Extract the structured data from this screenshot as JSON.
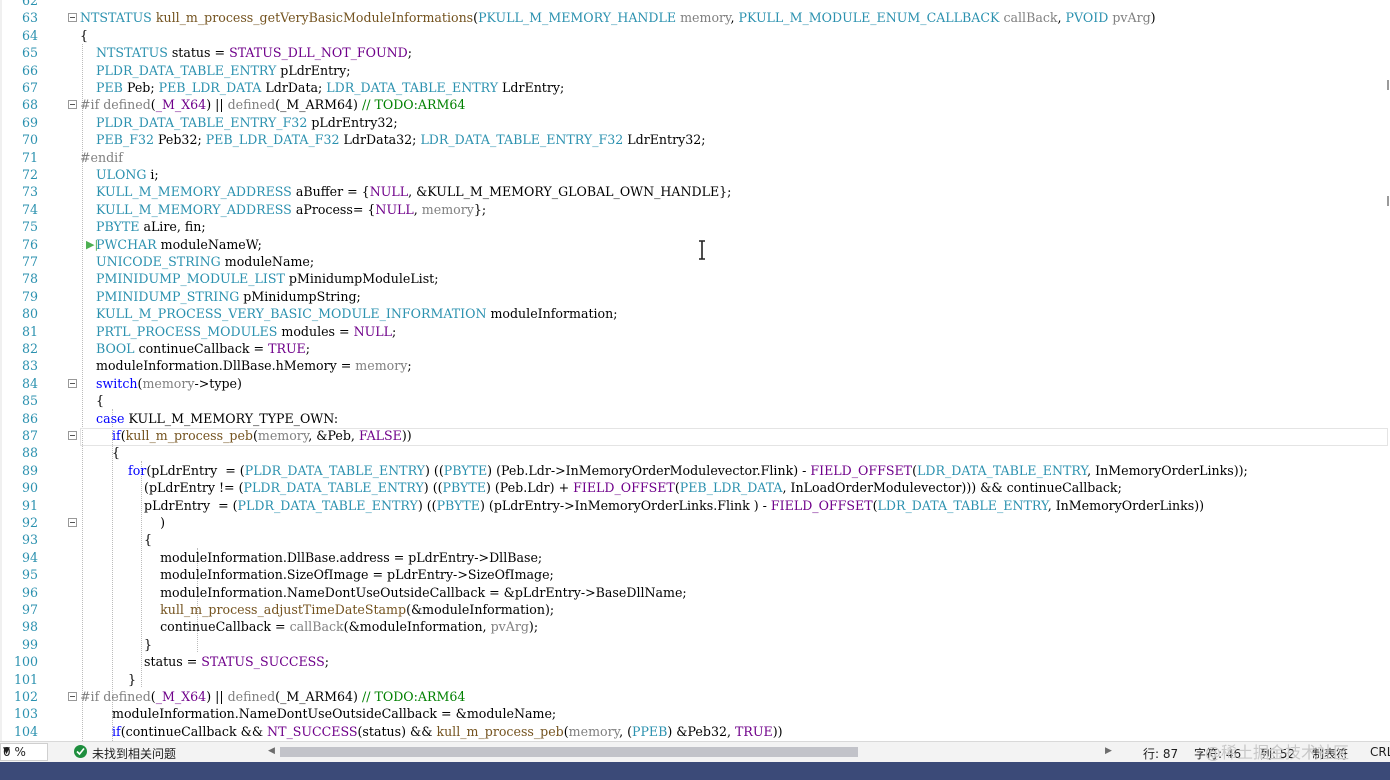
{
  "code_lines": [
    {
      "n": "62",
      "segs": []
    },
    {
      "n": "63",
      "fold": true,
      "segs": [
        [
          "t-type",
          "NTSTATUS"
        ],
        [
          "",
          " "
        ],
        [
          "t-fn",
          "kull_m_process_getVeryBasicModuleInformations"
        ],
        [
          "",
          "("
        ],
        [
          "t-type",
          "PKULL_M_MEMORY_HANDLE"
        ],
        [
          "",
          " "
        ],
        [
          "t-param",
          "memory"
        ],
        [
          "",
          ", "
        ],
        [
          "t-type",
          "PKULL_M_MODULE_ENUM_CALLBACK"
        ],
        [
          "",
          " "
        ],
        [
          "t-param",
          "callBack"
        ],
        [
          "",
          ", "
        ],
        [
          "t-type",
          "PVOID"
        ],
        [
          "",
          " "
        ],
        [
          "t-param",
          "pvArg"
        ],
        [
          "",
          ")"
        ]
      ]
    },
    {
      "n": "64",
      "segs": [
        [
          "",
          "{"
        ]
      ]
    },
    {
      "n": "65",
      "segs": [
        [
          "",
          "    "
        ],
        [
          "t-type",
          "NTSTATUS"
        ],
        [
          "",
          " status = "
        ],
        [
          "t-macro",
          "STATUS_DLL_NOT_FOUND"
        ],
        [
          "",
          ";"
        ]
      ]
    },
    {
      "n": "66",
      "segs": [
        [
          "",
          "    "
        ],
        [
          "t-type",
          "PLDR_DATA_TABLE_ENTRY"
        ],
        [
          "",
          " pLdrEntry;"
        ]
      ]
    },
    {
      "n": "67",
      "segs": [
        [
          "",
          "    "
        ],
        [
          "t-type",
          "PEB"
        ],
        [
          "",
          " Peb; "
        ],
        [
          "t-type",
          "PEB_LDR_DATA"
        ],
        [
          "",
          " LdrData; "
        ],
        [
          "t-type",
          "LDR_DATA_TABLE_ENTRY"
        ],
        [
          "",
          " LdrEntry;"
        ]
      ]
    },
    {
      "n": "68",
      "fold": true,
      "segs": [
        [
          "t-pp",
          "#if defined"
        ],
        [
          "",
          "("
        ],
        [
          "t-macro",
          "_M_X64"
        ],
        [
          "",
          ") || "
        ],
        [
          "t-pp",
          "defined"
        ],
        [
          "",
          "(_M_ARM64) "
        ],
        [
          "t-cm",
          "// TODO:ARM64"
        ]
      ]
    },
    {
      "n": "69",
      "segs": [
        [
          "",
          "    "
        ],
        [
          "t-type",
          "PLDR_DATA_TABLE_ENTRY_F32"
        ],
        [
          "",
          " pLdrEntry32;"
        ]
      ]
    },
    {
      "n": "70",
      "segs": [
        [
          "",
          "    "
        ],
        [
          "t-type",
          "PEB_F32"
        ],
        [
          "",
          " Peb32; "
        ],
        [
          "t-type",
          "PEB_LDR_DATA_F32"
        ],
        [
          "",
          " LdrData32; "
        ],
        [
          "t-type",
          "LDR_DATA_TABLE_ENTRY_F32"
        ],
        [
          "",
          " LdrEntry32;"
        ]
      ]
    },
    {
      "n": "71",
      "segs": [
        [
          "t-pp",
          "#endif"
        ]
      ]
    },
    {
      "n": "72",
      "segs": [
        [
          "",
          "    "
        ],
        [
          "t-type",
          "ULONG"
        ],
        [
          "",
          " i;"
        ]
      ]
    },
    {
      "n": "73",
      "segs": [
        [
          "",
          "    "
        ],
        [
          "t-type",
          "KULL_M_MEMORY_ADDRESS"
        ],
        [
          "",
          " aBuffer = {"
        ],
        [
          "t-macro",
          "NULL"
        ],
        [
          "",
          ", &KULL_M_MEMORY_GLOBAL_OWN_HANDLE};"
        ]
      ]
    },
    {
      "n": "74",
      "segs": [
        [
          "",
          "    "
        ],
        [
          "t-type",
          "KULL_M_MEMORY_ADDRESS"
        ],
        [
          "",
          " aProcess= {"
        ],
        [
          "t-macro",
          "NULL"
        ],
        [
          "",
          ", "
        ],
        [
          "t-param",
          "memory"
        ],
        [
          "",
          "};"
        ]
      ]
    },
    {
      "n": "75",
      "segs": [
        [
          "",
          "    "
        ],
        [
          "t-type",
          "PBYTE"
        ],
        [
          "",
          " aLire, fin;"
        ]
      ]
    },
    {
      "n": "76",
      "segs": [
        [
          "",
          "    "
        ],
        [
          "t-type",
          "PWCHAR"
        ],
        [
          "",
          " moduleNameW;"
        ]
      ]
    },
    {
      "n": "77",
      "segs": [
        [
          "",
          "    "
        ],
        [
          "t-type",
          "UNICODE_STRING"
        ],
        [
          "",
          " moduleName;"
        ]
      ]
    },
    {
      "n": "78",
      "segs": [
        [
          "",
          "    "
        ],
        [
          "t-type",
          "PMINIDUMP_MODULE_LIST"
        ],
        [
          "",
          " pMinidumpModuleList;"
        ]
      ]
    },
    {
      "n": "79",
      "segs": [
        [
          "",
          "    "
        ],
        [
          "t-type",
          "PMINIDUMP_STRING"
        ],
        [
          "",
          " pMinidumpString;"
        ]
      ]
    },
    {
      "n": "80",
      "segs": [
        [
          "",
          "    "
        ],
        [
          "t-type",
          "KULL_M_PROCESS_VERY_BASIC_MODULE_INFORMATION"
        ],
        [
          "",
          " moduleInformation;"
        ]
      ]
    },
    {
      "n": "81",
      "segs": [
        [
          "",
          "    "
        ],
        [
          "t-type",
          "PRTL_PROCESS_MODULES"
        ],
        [
          "",
          " modules = "
        ],
        [
          "t-macro",
          "NULL"
        ],
        [
          "",
          ";"
        ]
      ]
    },
    {
      "n": "82",
      "segs": [
        [
          "",
          "    "
        ],
        [
          "t-type",
          "BOOL"
        ],
        [
          "",
          " continueCallback = "
        ],
        [
          "t-macro",
          "TRUE"
        ],
        [
          "",
          ";"
        ]
      ]
    },
    {
      "n": "83",
      "segs": [
        [
          "",
          "    moduleInformation.DllBase.hMemory = "
        ],
        [
          "t-param",
          "memory"
        ],
        [
          "",
          ";"
        ]
      ]
    },
    {
      "n": "84",
      "fold": true,
      "segs": [
        [
          "",
          "    "
        ],
        [
          "t-kw",
          "switch"
        ],
        [
          "",
          "("
        ],
        [
          "t-param",
          "memory"
        ],
        [
          "",
          "->type)"
        ]
      ]
    },
    {
      "n": "85",
      "segs": [
        [
          "",
          "    {"
        ]
      ]
    },
    {
      "n": "86",
      "segs": [
        [
          "",
          "    "
        ],
        [
          "t-kw",
          "case"
        ],
        [
          "",
          " KULL_M_MEMORY_TYPE_OWN:"
        ]
      ]
    },
    {
      "n": "87",
      "fold": true,
      "segs": [
        [
          "",
          "        "
        ],
        [
          "t-kw",
          "if"
        ],
        [
          "",
          "("
        ],
        [
          "t-fn",
          "kull_m_process_peb"
        ],
        [
          "",
          "("
        ],
        [
          "t-param",
          "memory"
        ],
        [
          "",
          ", &Peb, "
        ],
        [
          "t-macro",
          "FALSE"
        ],
        [
          "",
          "))"
        ]
      ]
    },
    {
      "n": "88",
      "segs": [
        [
          "",
          "        {"
        ]
      ]
    },
    {
      "n": "89",
      "segs": [
        [
          "",
          "            "
        ],
        [
          "t-kw",
          "for"
        ],
        [
          "",
          "(pLdrEntry  = ("
        ],
        [
          "t-type",
          "PLDR_DATA_TABLE_ENTRY"
        ],
        [
          "",
          ") (("
        ],
        [
          "t-type",
          "PBYTE"
        ],
        [
          "",
          ") (Peb.Ldr->InMemoryOrderModulevector.Flink) - "
        ],
        [
          "t-macro",
          "FIELD_OFFSET"
        ],
        [
          "",
          "("
        ],
        [
          "t-type",
          "LDR_DATA_TABLE_ENTRY"
        ],
        [
          "",
          ", InMemoryOrderLinks));"
        ]
      ]
    },
    {
      "n": "90",
      "segs": [
        [
          "",
          "                (pLdrEntry != ("
        ],
        [
          "t-type",
          "PLDR_DATA_TABLE_ENTRY"
        ],
        [
          "",
          ") (("
        ],
        [
          "t-type",
          "PBYTE"
        ],
        [
          "",
          ") (Peb.Ldr) + "
        ],
        [
          "t-macro",
          "FIELD_OFFSET"
        ],
        [
          "",
          "("
        ],
        [
          "t-type",
          "PEB_LDR_DATA"
        ],
        [
          "",
          ", InLoadOrderModulevector))) && continueCallback;"
        ]
      ]
    },
    {
      "n": "91",
      "segs": [
        [
          "",
          "                pLdrEntry  = ("
        ],
        [
          "t-type",
          "PLDR_DATA_TABLE_ENTRY"
        ],
        [
          "",
          ") (("
        ],
        [
          "t-type",
          "PBYTE"
        ],
        [
          "",
          ") (pLdrEntry->InMemoryOrderLinks.Flink ) - "
        ],
        [
          "t-macro",
          "FIELD_OFFSET"
        ],
        [
          "",
          "("
        ],
        [
          "t-type",
          "LDR_DATA_TABLE_ENTRY"
        ],
        [
          "",
          ", InMemoryOrderLinks))"
        ]
      ]
    },
    {
      "n": "92",
      "fold": true,
      "segs": [
        [
          "",
          "                    )"
        ]
      ]
    },
    {
      "n": "93",
      "segs": [
        [
          "",
          "                {"
        ]
      ]
    },
    {
      "n": "94",
      "segs": [
        [
          "",
          "                    moduleInformation.DllBase.address = pLdrEntry->DllBase;"
        ]
      ]
    },
    {
      "n": "95",
      "segs": [
        [
          "",
          "                    moduleInformation.SizeOfImage = pLdrEntry->SizeOfImage;"
        ]
      ]
    },
    {
      "n": "96",
      "segs": [
        [
          "",
          "                    moduleInformation.NameDontUseOutsideCallback = &pLdrEntry->BaseDllName;"
        ]
      ]
    },
    {
      "n": "97",
      "segs": [
        [
          "",
          "                    "
        ],
        [
          "t-fn",
          "kull_m_process_adjustTimeDateStamp"
        ],
        [
          "",
          "(&moduleInformation);"
        ]
      ]
    },
    {
      "n": "98",
      "segs": [
        [
          "",
          "                    continueCallback = "
        ],
        [
          "t-param",
          "callBack"
        ],
        [
          "",
          "(&moduleInformation, "
        ],
        [
          "t-param",
          "pvArg"
        ],
        [
          "",
          ");"
        ]
      ]
    },
    {
      "n": "99",
      "segs": [
        [
          "",
          "                }"
        ]
      ]
    },
    {
      "n": "100",
      "segs": [
        [
          "",
          "                status = "
        ],
        [
          "t-macro",
          "STATUS_SUCCESS"
        ],
        [
          "",
          ";"
        ]
      ]
    },
    {
      "n": "101",
      "segs": [
        [
          "",
          "            }"
        ]
      ]
    },
    {
      "n": "102",
      "fold": true,
      "segs": [
        [
          "t-pp",
          "#if defined"
        ],
        [
          "",
          "("
        ],
        [
          "t-macro",
          "_M_X64"
        ],
        [
          "",
          ") || "
        ],
        [
          "t-pp",
          "defined"
        ],
        [
          "",
          "(_M_ARM64) "
        ],
        [
          "t-cm",
          "// TODO:ARM64"
        ]
      ]
    },
    {
      "n": "103",
      "segs": [
        [
          "",
          "        moduleInformation.NameDontUseOutsideCallback = &moduleName;"
        ]
      ]
    },
    {
      "n": "104",
      "segs": [
        [
          "",
          "        "
        ],
        [
          "t-kw",
          "if"
        ],
        [
          "",
          "(continueCallback && "
        ],
        [
          "t-macro",
          "NT_SUCCESS"
        ],
        [
          "",
          "(status) && "
        ],
        [
          "t-fn",
          "kull_m_process_peb"
        ],
        [
          "",
          "("
        ],
        [
          "t-param",
          "memory"
        ],
        [
          "",
          ", ("
        ],
        [
          "t-type",
          "PPEB"
        ],
        [
          "",
          ") &Peb32, "
        ],
        [
          "t-macro",
          "TRUE"
        ],
        [
          "",
          "))"
        ]
      ]
    }
  ],
  "status": {
    "zoom": "0 %",
    "problems": "未找到相关问题",
    "line_label": "行: 87",
    "char_label": "字符: 46",
    "col_label": "列: 52",
    "tab_label": "制表符",
    "eol_label": "CRL"
  },
  "watermark": "@稀土掘金技术社区",
  "colors": {
    "type": "#2b91af",
    "keyword": "#0000ff",
    "macro": "#6f008a",
    "function": "#74531f",
    "comment": "#008000",
    "line_number": "#2b91af"
  }
}
